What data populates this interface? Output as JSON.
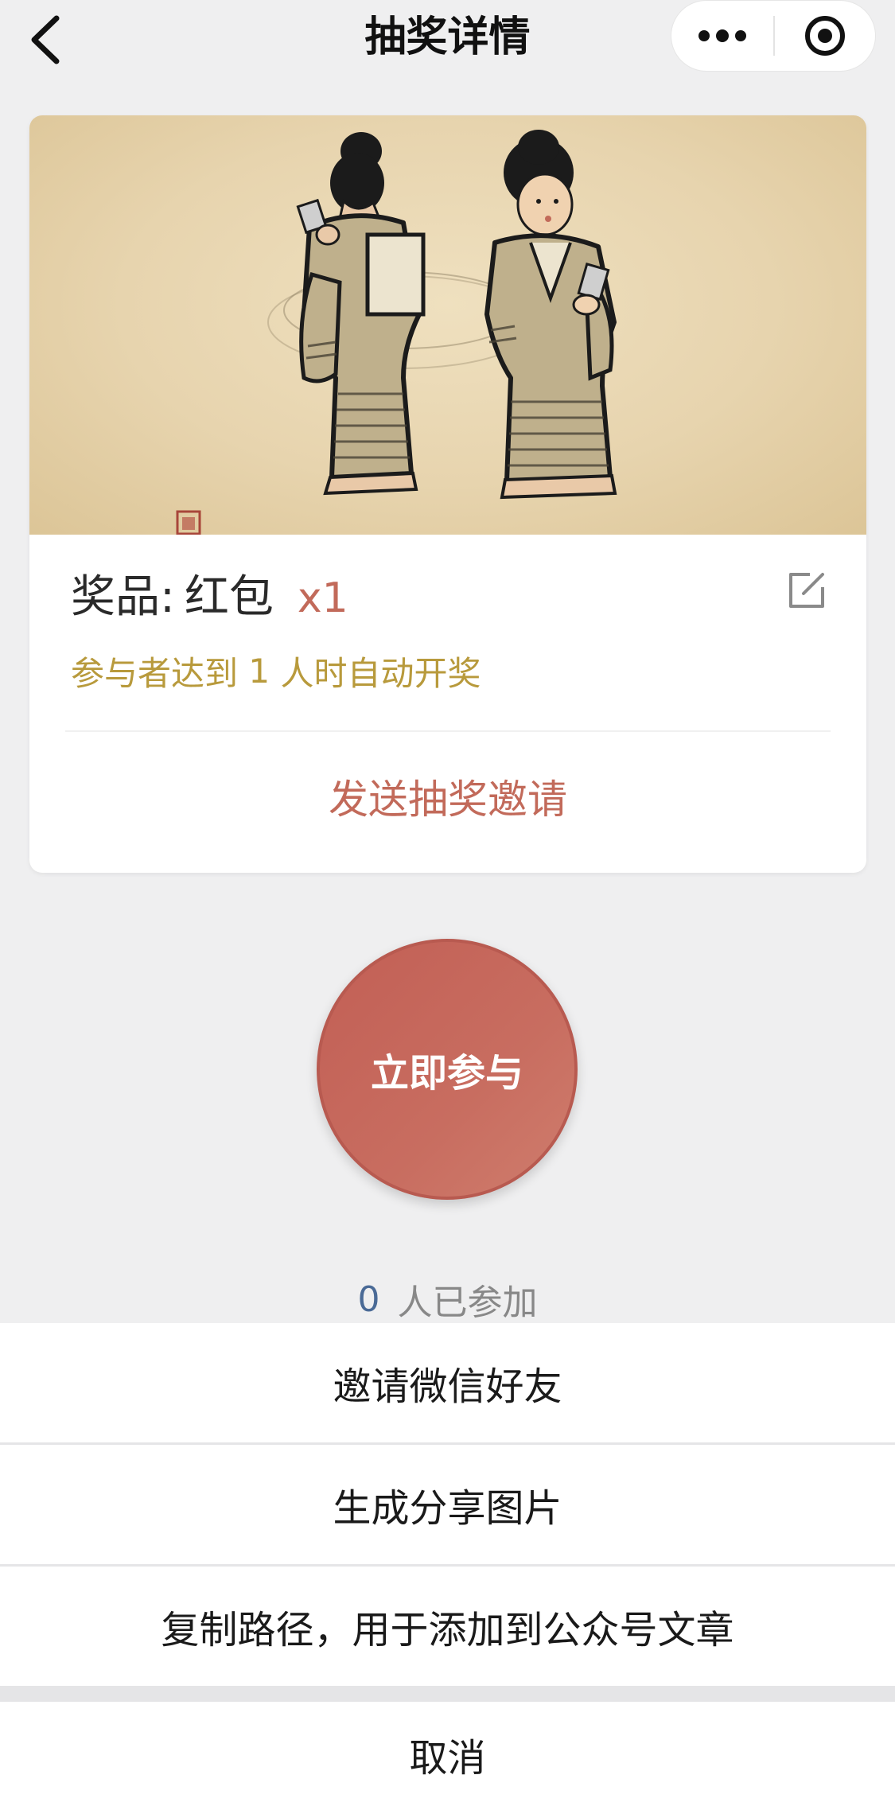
{
  "navbar": {
    "title": "抽奖详情",
    "back_icon": "chevron-left-icon",
    "more_icon": "more-dots-icon",
    "close_icon": "target-close-icon"
  },
  "card": {
    "image_alt": "two-ladies-in-kimono-illustration",
    "prize_label": "奖品:",
    "prize_name": "红包",
    "prize_qty": "x1",
    "rule_prefix": "参与者达到",
    "rule_count": "1",
    "rule_suffix": "人时自动开奖",
    "invite_label": "发送抽奖邀请",
    "edit_icon": "edit-icon"
  },
  "join": {
    "label": "立即参与"
  },
  "participants": {
    "count": "0",
    "label": "人已参加"
  },
  "sheet": {
    "items": [
      {
        "label": "邀请微信好友"
      },
      {
        "label": "生成分享图片"
      },
      {
        "label": "复制路径，用于添加到公众号文章"
      }
    ],
    "cancel_label": "取消"
  },
  "colors": {
    "accent": "#c26a5a",
    "rule": "#b89a3c",
    "count": "#4a6a96",
    "background": "#efeff0"
  }
}
